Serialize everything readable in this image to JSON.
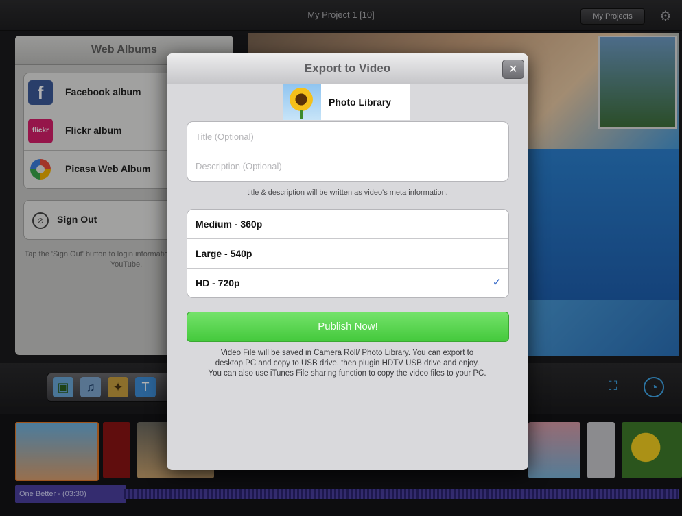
{
  "app": {
    "project_title": "My Project 1  [10]",
    "my_projects_label": "My Projects"
  },
  "web_albums": {
    "header": "Web Albums",
    "items": [
      {
        "label": "Facebook album",
        "icon": "facebook-icon",
        "icon_text": "f",
        "color": "#3b5998"
      },
      {
        "label": "Flickr album",
        "icon": "flickr-icon",
        "icon_text": "flickr",
        "color": "#d61f6b"
      },
      {
        "label": "Picasa Web Album",
        "icon": "picasa-icon",
        "icon_text": "",
        "color": "#e8e8e8"
      }
    ],
    "sign_out_label": "Sign Out",
    "sign_out_help": "Tap the 'Sign Out' button to login information of all above and YouTube."
  },
  "timeline": {
    "clip_label": "One Better - (03:30)"
  },
  "modal": {
    "title": "Export to Video",
    "close_label": "×",
    "destination_label": "Photo Library",
    "title_placeholder": "Title (Optional)",
    "description_placeholder": "Description (Optional)",
    "meta_note": "title & description will be written as  video's meta information.",
    "resolutions": [
      {
        "label": "Medium - 360p",
        "selected": false
      },
      {
        "label": "Large - 540p",
        "selected": false
      },
      {
        "label": "HD - 720p",
        "selected": true
      }
    ],
    "check_mark": "✓",
    "publish_label": "Publish Now!",
    "info_line1": "Video File will be saved in Camera Roll/ Photo Library. You can export to desktop PC and copy to USB drive. then plugin HDTV USB drive and enjoy.",
    "info_line2": "You can also use iTunes File sharing function to copy the video files to your PC."
  },
  "colors": {
    "publish_green": "#4ccd44",
    "check_blue": "#3a6cc9",
    "timeline_purple": "#4b3fa0"
  }
}
